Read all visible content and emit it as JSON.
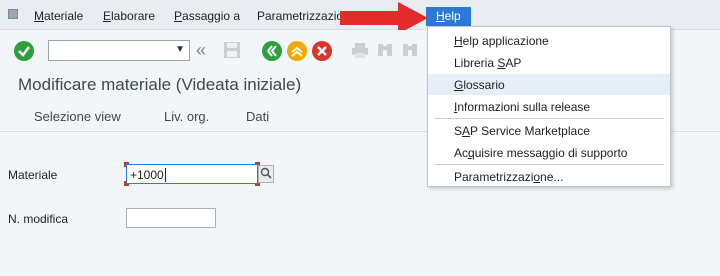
{
  "menu": {
    "items": [
      {
        "label": "Materiale",
        "key": "M"
      },
      {
        "label": "Elaborare",
        "key": "E"
      },
      {
        "label": "Passaggio a",
        "key": "P"
      },
      {
        "label": "Parametrizzazione"
      },
      {
        "label": "Help",
        "key": "H",
        "active": true
      }
    ]
  },
  "toolbar": {
    "command_field_value": "",
    "icons": [
      "enter-check-icon",
      "command-dropdown-icon",
      "back-double-chevron-icon",
      "save-icon",
      "back-green-icon",
      "exit-yellow-icon",
      "cancel-red-icon",
      "print-icon",
      "find-icon",
      "find-next-icon"
    ]
  },
  "page": {
    "title": "Modificare materiale (Videata iniziale)"
  },
  "app_toolbar": {
    "buttons": [
      "Selezione view",
      "Liv. org.",
      "Dati"
    ]
  },
  "form": {
    "material_label": "Materiale",
    "material_value": "+1000",
    "change_number_label": "N. modifica",
    "change_number_value": ""
  },
  "help_menu": {
    "items": [
      "Help applicazione",
      "Libreria SAP",
      "Glossario",
      "Informazioni sulla release",
      "SAP Service Marketplace",
      "Acquisire messaggio di supporto",
      "Parametrizzazione..."
    ],
    "hovered": "Glossario"
  },
  "colors": {
    "menu_active": "#2d7ad6",
    "annotation_arrow": "#e32b2b",
    "check_green": "#2e9e3e",
    "back_green": "#2e9e3e",
    "exit_yellow": "#f2a900",
    "cancel_red": "#d9342b"
  }
}
